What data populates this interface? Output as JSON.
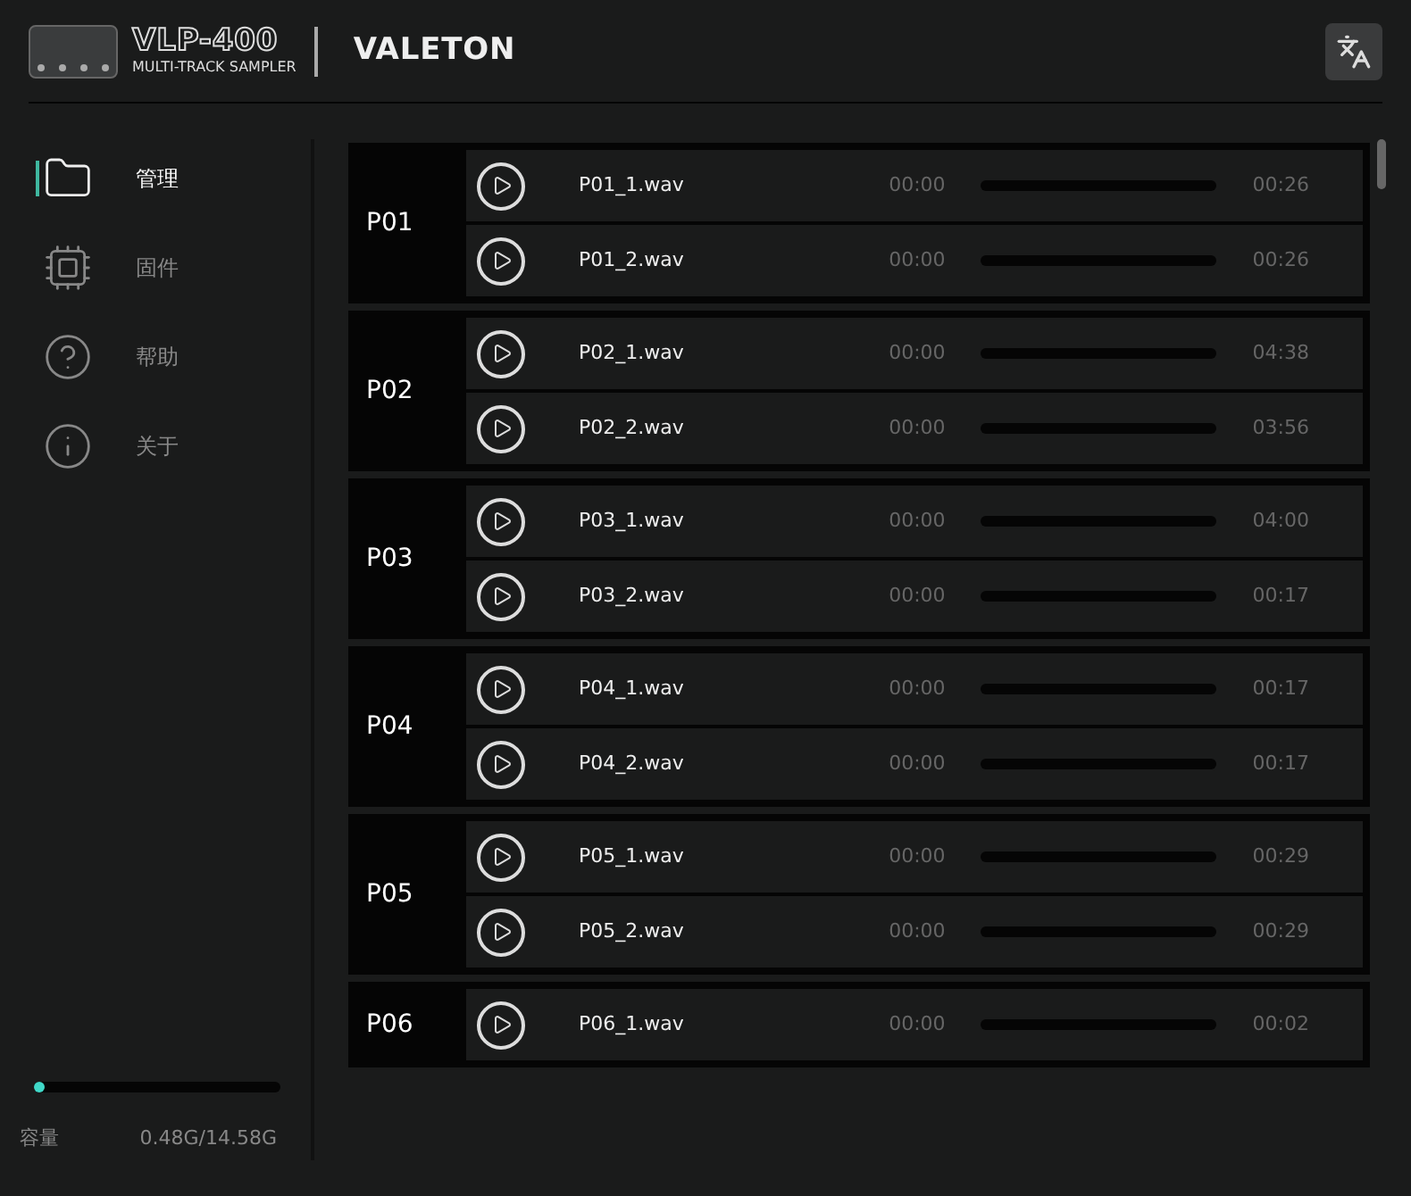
{
  "header": {
    "product": "VLP-400",
    "subtitle": "MULTI-TRACK SAMPLER",
    "brand": "VALETON"
  },
  "sidebar": {
    "items": [
      {
        "kind": "folder",
        "label": "管理",
        "selected": true
      },
      {
        "kind": "chip",
        "label": "固件",
        "selected": false
      },
      {
        "kind": "help",
        "label": "帮助",
        "selected": false
      },
      {
        "kind": "info",
        "label": "关于",
        "selected": false
      }
    ],
    "storage": {
      "level": 0.04,
      "label": "容量",
      "value": "0.48G/14.58G"
    }
  },
  "presets": [
    {
      "name": "P01",
      "tracks": [
        {
          "file": "P01_1.wav",
          "elapsed": "00:00",
          "level": 0,
          "duration": "00:26"
        },
        {
          "file": "P01_2.wav",
          "elapsed": "00:00",
          "level": 0,
          "duration": "00:26"
        }
      ]
    },
    {
      "name": "P02",
      "tracks": [
        {
          "file": "P02_1.wav",
          "elapsed": "00:00",
          "level": 0,
          "duration": "04:38"
        },
        {
          "file": "P02_2.wav",
          "elapsed": "00:00",
          "level": 0,
          "duration": "03:56"
        }
      ]
    },
    {
      "name": "P03",
      "tracks": [
        {
          "file": "P03_1.wav",
          "elapsed": "00:00",
          "level": 0,
          "duration": "04:00"
        },
        {
          "file": "P03_2.wav",
          "elapsed": "00:00",
          "level": 0,
          "duration": "00:17"
        }
      ]
    },
    {
      "name": "P04",
      "tracks": [
        {
          "file": "P04_1.wav",
          "elapsed": "00:00",
          "level": 0,
          "duration": "00:17"
        },
        {
          "file": "P04_2.wav",
          "elapsed": "00:00",
          "level": 0,
          "duration": "00:17"
        }
      ]
    },
    {
      "name": "P05",
      "tracks": [
        {
          "file": "P05_1.wav",
          "elapsed": "00:00",
          "level": 0,
          "duration": "00:29"
        },
        {
          "file": "P05_2.wav",
          "elapsed": "00:00",
          "level": 0,
          "duration": "00:29"
        }
      ]
    },
    {
      "name": "P06",
      "tracks": [
        {
          "file": "P06_1.wav",
          "elapsed": "00:00",
          "level": 0,
          "duration": "00:02"
        }
      ]
    }
  ]
}
